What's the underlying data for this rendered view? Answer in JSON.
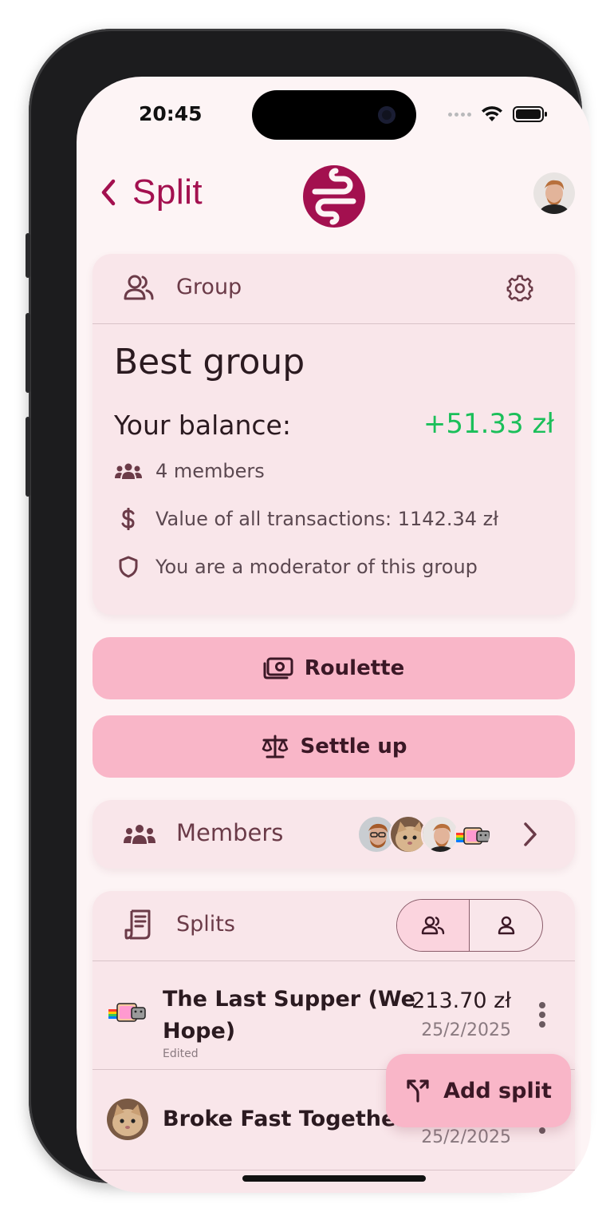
{
  "status_bar": {
    "time": "20:45"
  },
  "header": {
    "back_label": "Split"
  },
  "group": {
    "section_label": "Group",
    "name": "Best group",
    "balance_label": "Your balance:",
    "balance_value": "+51.33 zł",
    "members_text": "4 members",
    "transactions_text": "Value of all transactions: 1142.34 zł",
    "moderator_text": "You are a moderator of this group"
  },
  "actions": {
    "roulette_label": "Roulette",
    "settle_label": "Settle up"
  },
  "members": {
    "label": "Members"
  },
  "splits": {
    "label": "Splits",
    "items": [
      {
        "title_line1": "The Last Supper (We",
        "title_line2": "Hope)",
        "edited": "Edited",
        "amount": "213.70 zł",
        "date": "25/2/2025"
      },
      {
        "title_line1": "Broke Fast Together",
        "date": "25/2/2025"
      }
    ]
  },
  "fab": {
    "label": "Add split"
  },
  "colors": {
    "brand": "#a3104f",
    "positive": "#1bbf5a",
    "button_bg": "#f9b6c8",
    "card_bg": "#f9e6ea",
    "screen_bg": "#fdf4f5"
  }
}
